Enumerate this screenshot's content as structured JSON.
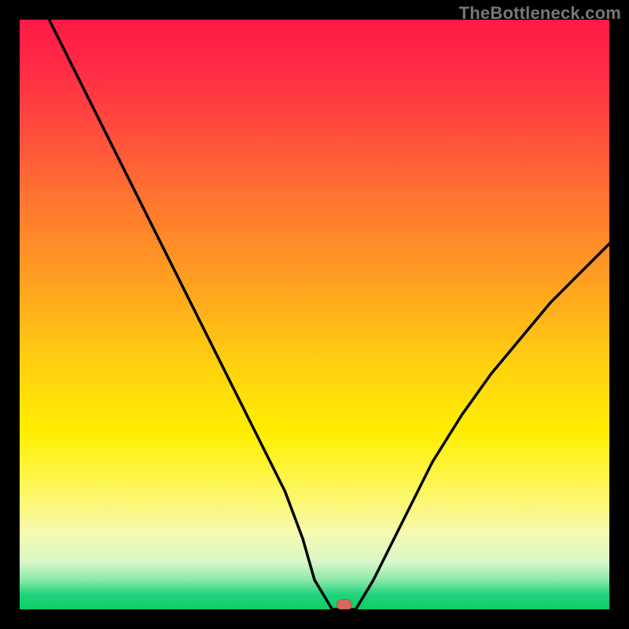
{
  "attribution": "TheBottleneck.com",
  "colors": {
    "frame": "#000000",
    "curve": "#000000",
    "marker": "#d86a5a",
    "gradient_top": "#ff1a47",
    "gradient_bottom": "#0ecf66"
  },
  "chart_data": {
    "type": "line",
    "title": "",
    "xlabel": "",
    "ylabel": "",
    "xlim": [
      0,
      100
    ],
    "ylim": [
      0,
      100
    ],
    "grid": false,
    "legend": false,
    "x": [
      5,
      10,
      15,
      20,
      24,
      30,
      35,
      40,
      45,
      48,
      50,
      53,
      55,
      57,
      60,
      65,
      70,
      75,
      80,
      85,
      90,
      95,
      100
    ],
    "y": [
      100,
      90,
      80,
      70,
      62,
      50,
      40,
      30,
      20,
      12,
      5,
      0,
      0,
      0,
      5,
      15,
      25,
      33,
      40,
      46,
      52,
      57,
      62
    ],
    "series": [
      {
        "name": "bottleneck-curve",
        "x_key": "x",
        "y_key": "y"
      }
    ],
    "marker": {
      "x": 55,
      "y": 0
    },
    "background_gradient_stops": [
      {
        "pct": 0,
        "color": "#ff1a47"
      },
      {
        "pct": 18,
        "color": "#ff4a3e"
      },
      {
        "pct": 45,
        "color": "#ffa220"
      },
      {
        "pct": 70,
        "color": "#ffee00"
      },
      {
        "pct": 92,
        "color": "#d8f8c8"
      },
      {
        "pct": 100,
        "color": "#0ecf66"
      }
    ]
  }
}
